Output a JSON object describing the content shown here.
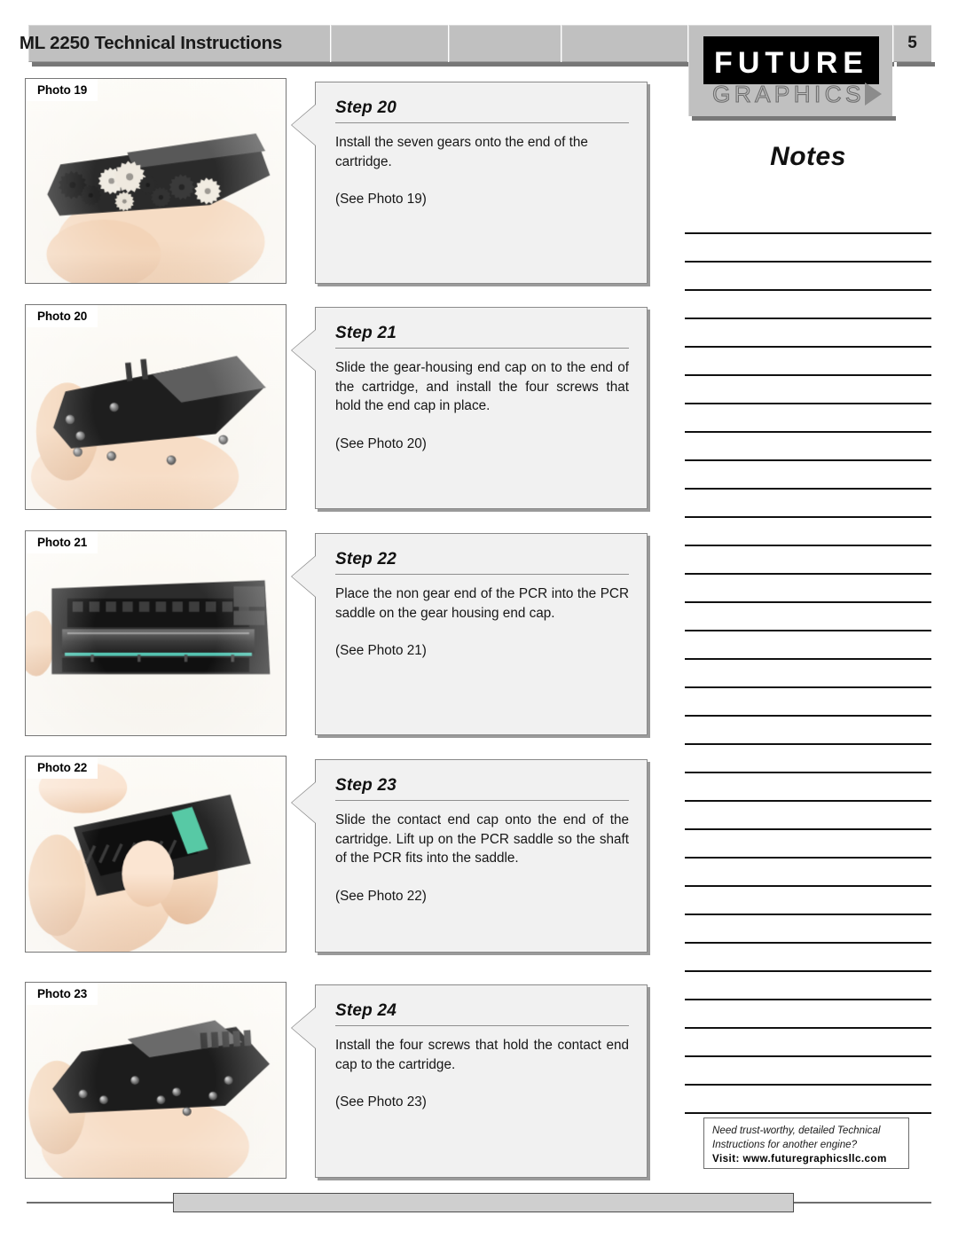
{
  "header": {
    "title": "ML 2250 Technical Instructions",
    "page_number": "5",
    "logo": {
      "line1": "FUTURE",
      "line2": "GRAPHICS"
    }
  },
  "notes": {
    "title": "Notes",
    "line_count": 32
  },
  "promo": {
    "line1": "Need trust-worthy, detailed Technical",
    "line2": "Instructions for another engine?",
    "visit": "Visit: www.futuregraphicsllc.com"
  },
  "photos": [
    {
      "label": "Photo 19",
      "alt": "Hand holding the gear end of a toner cartridge with seven gears installed"
    },
    {
      "label": "Photo 20",
      "alt": "Hand holding the cartridge with the gear-housing end cap installed"
    },
    {
      "label": "Photo 21",
      "alt": "Cartridge with the PCR roller resting in the PCR saddle"
    },
    {
      "label": "Photo 22",
      "alt": "Two hands sliding the contact end cap onto the end of the cartridge"
    },
    {
      "label": "Photo 23",
      "alt": "Hand holding the cartridge with the contact end cap screwed in place"
    }
  ],
  "steps": [
    {
      "heading": "Step 20",
      "body": "Install the seven gears onto the end of the cartridge.",
      "see": "(See Photo 19)",
      "justify": false
    },
    {
      "heading": "Step 21",
      "body": "Slide the gear-housing end cap on to the end of the cartridge, and install the four screws that hold the end cap in place.",
      "see": "(See Photo 20)",
      "justify": true
    },
    {
      "heading": "Step 22",
      "body": "Place the non gear end of the PCR into the PCR saddle on the gear housing end cap.",
      "see": "(See Photo 21)",
      "justify": true
    },
    {
      "heading": "Step 23",
      "body": "Slide the contact end cap onto the end of the cartridge. Lift up on the PCR saddle so the shaft of the PCR fits into the saddle.",
      "see": "(See Photo 22)",
      "justify": true
    },
    {
      "heading": "Step 24",
      "body": "Install the four screws that hold the contact end cap to the cartridge.",
      "see": "(See Photo 23)",
      "justify": true
    }
  ],
  "colors": {
    "header_gray": "#c0c0c0",
    "step_fill": "#f1f1f1",
    "rule_gray": "#6e6e6e"
  }
}
